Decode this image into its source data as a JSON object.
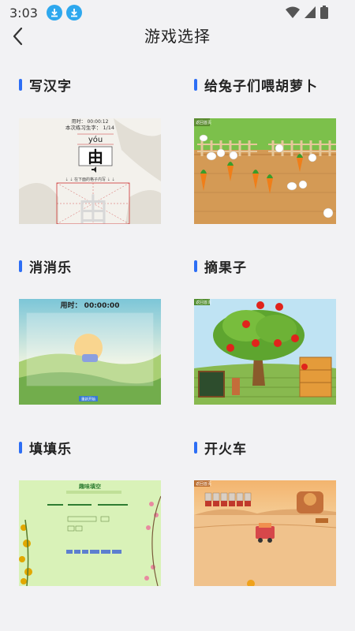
{
  "status_bar": {
    "time": "3:03"
  },
  "header": {
    "title": "游戏选择"
  },
  "games": [
    {
      "name": "写汉字",
      "thumb": {
        "timer": "用时： 00:00:12",
        "progress": "本次练习生字： 1/14",
        "pinyin": "yóu",
        "character": "由",
        "hint": "⇣ ⇣ 在下面的格子内写 ⇣ ⇣"
      }
    },
    {
      "name": "给兔子们喂胡萝卜",
      "thumb": {
        "corner": "返回首页"
      }
    },
    {
      "name": "消消乐",
      "thumb": {
        "timer": "用时：  00:00:00",
        "button": "重新开始"
      }
    },
    {
      "name": "摘果子",
      "thumb": {
        "corner": "返回首页"
      }
    },
    {
      "name": "填填乐",
      "thumb": {
        "heading": "趣味填空"
      }
    },
    {
      "name": "开火车",
      "thumb": {
        "corner": "返回首页"
      }
    }
  ],
  "colors": {
    "accent": "#2d6ef5",
    "badge": "#2ea8ee"
  }
}
